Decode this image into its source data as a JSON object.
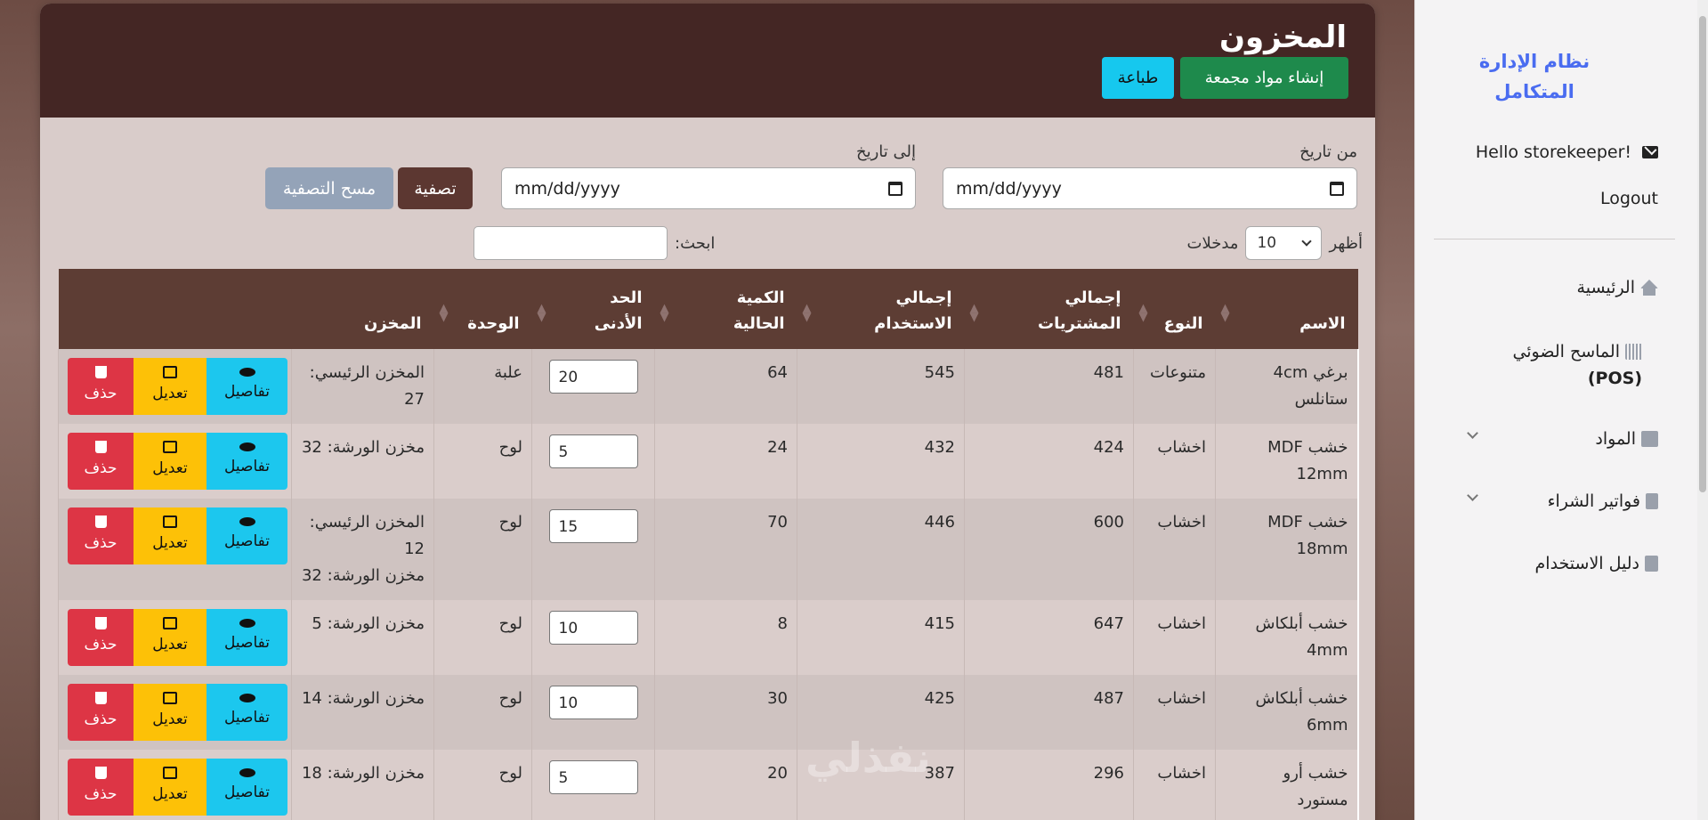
{
  "sidebar": {
    "brand": "نظام الإدارة المتكامل",
    "greeting": "Hello storekeeper!",
    "logout": "Logout",
    "items": [
      {
        "label": "الرئيسية",
        "icon": "home-icon"
      },
      {
        "label_line1": "الماسح الضوئي",
        "label_line2": "(POS)",
        "icon": "barcode-icon"
      },
      {
        "label": "المواد",
        "icon": "box-icon"
      },
      {
        "label": "فواتير الشراء",
        "icon": "invoice-icon"
      },
      {
        "label": "دليل الاستخدام",
        "icon": "book-icon"
      }
    ]
  },
  "header": {
    "title": "المخزون",
    "create_button": "إنشاء مواد مجمعة",
    "print_button": "طباعة"
  },
  "filters": {
    "from_label": "من تاريخ",
    "to_label": "إلى تاريخ",
    "from_placeholder": "mm/dd/yyyy",
    "to_placeholder": "mm/dd/yyyy",
    "filter_button": "تصفية",
    "clear_button": "مسح التصفية",
    "show_label": "أظهر",
    "entries_value": "10",
    "entries_label": "مدخلات",
    "search_label": "ابحث:"
  },
  "table": {
    "columns": [
      "الاسم",
      "النوع",
      "إجمالي المشتريات",
      "إجمالي الاستخدام",
      "الكمية الحالية",
      "الحد الأدنى",
      "الوحدة",
      "المخزن"
    ],
    "columns_split": [
      [
        "الاسم"
      ],
      [
        "النوع"
      ],
      [
        "إجمالي",
        "المشتريات"
      ],
      [
        "إجمالي",
        "الاستخدام"
      ],
      [
        "الكمية",
        "الحالية"
      ],
      [
        "الحد",
        "الأدنى"
      ],
      [
        "الوحدة"
      ],
      [
        "المخزن"
      ]
    ],
    "actions": {
      "details": "تفاصيل",
      "edit": "تعديل",
      "delete": "حذف"
    },
    "rows": [
      {
        "name_l1": "برغي 4cm",
        "name_l2": "ستانلس",
        "type": "متنوعات",
        "purchases": "481",
        "usage": "545",
        "current": "64",
        "min": "20",
        "unit": "علبة",
        "store_l1": "المخزن الرئيسي:",
        "store_l2": "27",
        "store_l3": ""
      },
      {
        "name_l1": "خشب MDF",
        "name_l2": "12mm",
        "type": "اخشاب",
        "purchases": "424",
        "usage": "432",
        "current": "24",
        "min": "5",
        "unit": "لوح",
        "store_l1": "مخزن الورشة: 32",
        "store_l2": "",
        "store_l3": ""
      },
      {
        "name_l1": "خشب MDF",
        "name_l2": "18mm",
        "type": "اخشاب",
        "purchases": "600",
        "usage": "446",
        "current": "70",
        "min": "15",
        "unit": "لوح",
        "store_l1": "المخزن الرئيسي:",
        "store_l2": "12",
        "store_l3": "مخزن الورشة: 32"
      },
      {
        "name_l1": "خشب أبلكاش",
        "name_l2": "4mm",
        "type": "اخشاب",
        "purchases": "647",
        "usage": "415",
        "current": "8",
        "min": "10",
        "unit": "لوح",
        "store_l1": "مخزن الورشة: 5",
        "store_l2": "",
        "store_l3": ""
      },
      {
        "name_l1": "خشب أبلكاش",
        "name_l2": "6mm",
        "type": "اخشاب",
        "purchases": "487",
        "usage": "425",
        "current": "30",
        "min": "10",
        "unit": "لوح",
        "store_l1": "مخزن الورشة: 14",
        "store_l2": "",
        "store_l3": ""
      },
      {
        "name_l1": "خشب أرو",
        "name_l2": "مستورد",
        "type": "اخشاب",
        "purchases": "296",
        "usage": "387",
        "current": "20",
        "min": "5",
        "unit": "لوح",
        "store_l1": "مخزن الورشة: 18",
        "store_l2": "",
        "store_l3": ""
      }
    ]
  },
  "watermark": "نفذلي",
  "colors": {
    "header": "#442624",
    "table_head": "#5d3d34",
    "green": "#1e8a4c",
    "cyan": "#16c8ee",
    "yellow": "#fdc107",
    "red": "#dd3545",
    "brand": "#4a6cf0"
  }
}
